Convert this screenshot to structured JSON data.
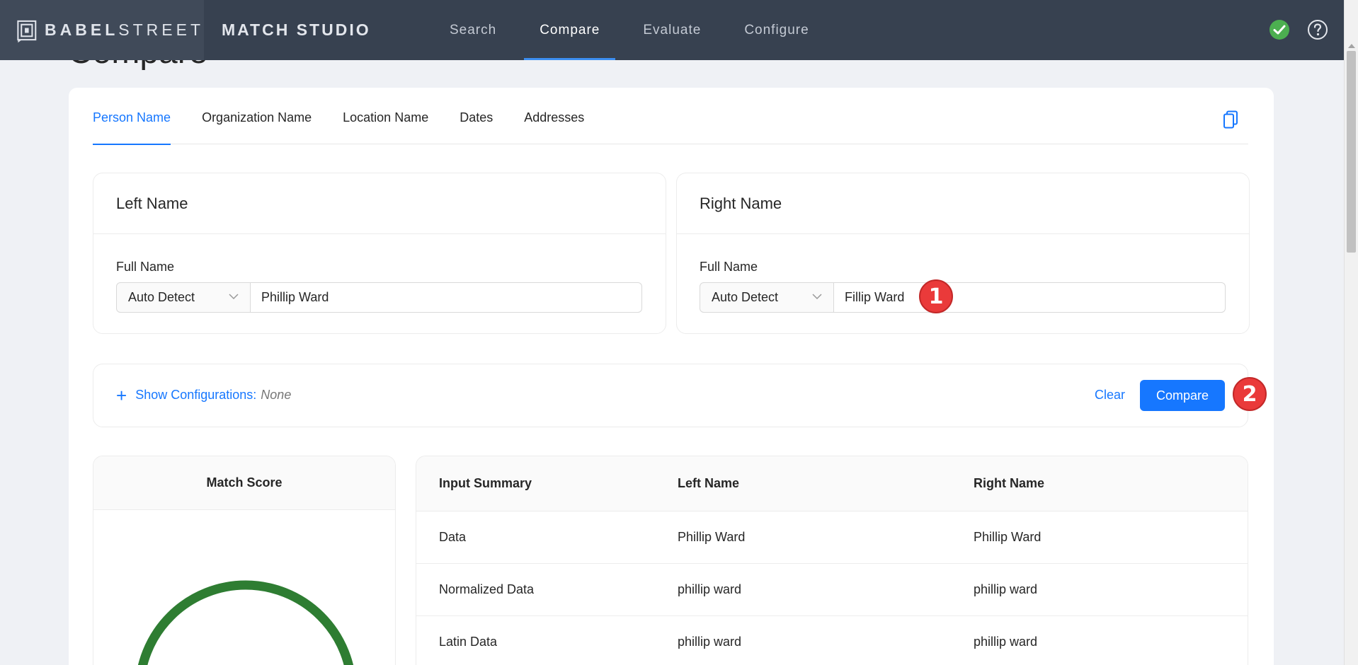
{
  "brand": {
    "name_bold": "BABEL",
    "name_rest": "STREET",
    "product": "MATCH STUDIO"
  },
  "nav": {
    "items": [
      "Search",
      "Compare",
      "Evaluate",
      "Configure"
    ],
    "active": "Compare"
  },
  "page": {
    "heading": "Compare"
  },
  "tabs": {
    "items": [
      "Person Name",
      "Organization Name",
      "Location Name",
      "Dates",
      "Addresses"
    ],
    "active": "Person Name"
  },
  "left": {
    "title": "Left Name",
    "field_label": "Full Name",
    "language": "Auto Detect",
    "value": "Phillip Ward"
  },
  "right": {
    "title": "Right Name",
    "field_label": "Full Name",
    "language": "Auto Detect",
    "value": "Fillip Ward"
  },
  "config": {
    "show_label": "Show Configurations:",
    "value": "None",
    "clear_label": "Clear",
    "compare_label": "Compare"
  },
  "markers": {
    "one": "1",
    "two": "2"
  },
  "score": {
    "title": "Match Score"
  },
  "summary": {
    "headers": [
      "Input Summary",
      "Left Name",
      "Right Name"
    ],
    "rows": [
      [
        "Data",
        "Phillip Ward",
        "Phillip Ward"
      ],
      [
        "Normalized Data",
        "phillip ward",
        "phillip ward"
      ],
      [
        "Latin Data",
        "phillip ward",
        "phillip ward"
      ]
    ]
  },
  "colors": {
    "accent": "#1677ff",
    "topbar": "#374150",
    "status_ok": "#4caf50",
    "gauge": "#2e7d32",
    "marker": "#ea3a3a"
  }
}
